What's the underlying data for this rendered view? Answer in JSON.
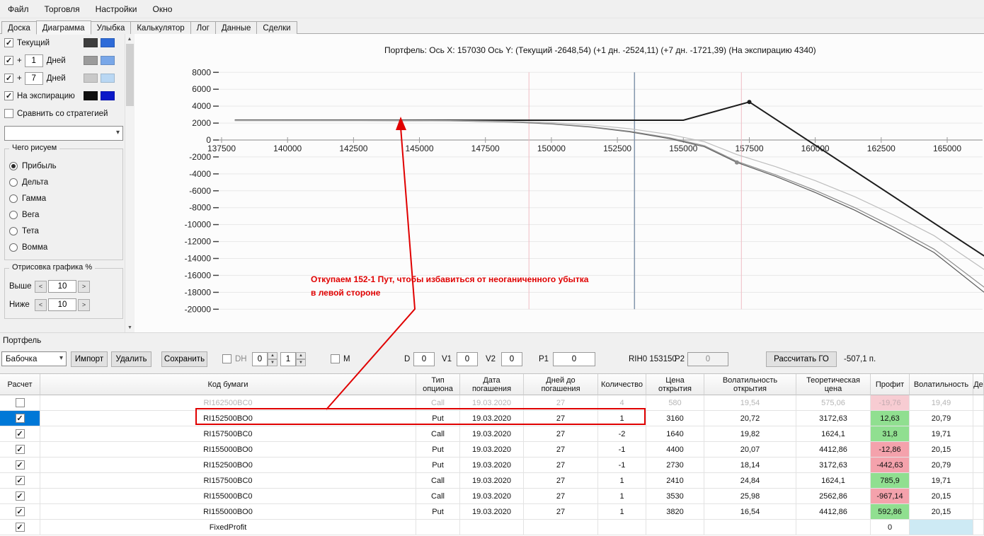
{
  "colors": {
    "profit_green": "#90df90",
    "profit_red": "#f4a2ac",
    "profit_red_faded": "#f7ccd2",
    "disabled_text": "#c4abb0",
    "row_selected": "#0078d7",
    "vol_blue": "#cdeaf4",
    "annotation_red": "#e00000"
  },
  "menu": {
    "items": [
      "Файл",
      "Торговля",
      "Настройки",
      "Окно"
    ]
  },
  "tabs": {
    "items": [
      "Доска",
      "Диаграмма",
      "Улыбка",
      "Калькулятор",
      "Лог",
      "Данные",
      "Сделки"
    ],
    "active": "Диаграмма"
  },
  "sidebar": {
    "toggles": [
      {
        "label": "Текущий",
        "checked": true,
        "swatch1": "#3d3d3d",
        "swatch2": "#2e6bd8"
      },
      {
        "prefix": "+",
        "value": "1",
        "label": "Дней",
        "checked": true,
        "swatch1": "#9b9b9b",
        "swatch2": "#79a7e8"
      },
      {
        "prefix": "+",
        "value": "7",
        "label": "Дней",
        "checked": true,
        "swatch1": "#c9c9c9",
        "swatch2": "#b9d7f3"
      },
      {
        "label": "На экспирацию",
        "checked": true,
        "swatch1": "#101010",
        "swatch2": "#0b18c8"
      }
    ],
    "compare": {
      "label": "Сравнить со стратегией",
      "checked": false
    },
    "draw": {
      "title": "Чего рисуем",
      "options": [
        "Прибыль",
        "Дельта",
        "Гамма",
        "Вега",
        "Тета",
        "Вомма"
      ],
      "selected": "Прибыль"
    },
    "scale": {
      "title": "Отрисовка графика %",
      "rows": [
        {
          "label": "Выше",
          "value": "10"
        },
        {
          "label": "Ниже",
          "value": "10"
        }
      ]
    }
  },
  "annotation": {
    "line1": "Откупаем 152-1 Пут, чтобы избавиться от неоганиченного убытка",
    "line2": "в левой стороне"
  },
  "portfolio": {
    "label": "Портфель",
    "strategy_value": "Бабочка",
    "import_btn": "Импорт",
    "delete_btn": "Удалить",
    "save_btn": "Сохранить",
    "dh_label": "DH",
    "dh_val1": "0",
    "dh_val2": "1",
    "m_label": "M",
    "d_label": "D",
    "d_value": "0",
    "v1_label": "V1",
    "v1_value": "0",
    "v2_label": "V2",
    "v2_value": "0",
    "p1_label": "P1",
    "p1_value": "0",
    "instrument": "RIH0 153150",
    "p2_label": "P2",
    "p2_value": "0",
    "calc_btn": "Рассчитать ГО",
    "margin_value": "-507,1 п."
  },
  "table": {
    "headers": [
      "Расчет",
      "Код бумаги",
      "Тип\nопциона",
      "Дата\nпогашения",
      "Дней до\nпогашения",
      "Количество",
      "Цена\nоткрытия",
      "Волатильность\nоткрытия",
      "Теоретическая\nцена",
      "Профит",
      "Волатильность",
      "Де"
    ],
    "rows": [
      {
        "checked": false,
        "selected": false,
        "disabled": true,
        "code": "RI162500BC0",
        "type": "Call",
        "expiry": "19.03.2020",
        "days": "27",
        "qty": "4",
        "open_price": "580",
        "open_vol": "19,54",
        "theo_price": "575,06",
        "profit": "-19,76",
        "profit_color": "red",
        "vol": "19,49",
        "vol_bg": ""
      },
      {
        "checked": true,
        "selected": true,
        "disabled": false,
        "code": "RI152500BO0",
        "type": "Put",
        "expiry": "19.03.2020",
        "days": "27",
        "qty": "1",
        "open_price": "3160",
        "open_vol": "20,72",
        "theo_price": "3172,63",
        "profit": "12,63",
        "profit_color": "green",
        "vol": "20,79",
        "vol_bg": ""
      },
      {
        "checked": true,
        "selected": false,
        "disabled": false,
        "code": "RI157500BC0",
        "type": "Call",
        "expiry": "19.03.2020",
        "days": "27",
        "qty": "-2",
        "open_price": "1640",
        "open_vol": "19,82",
        "theo_price": "1624,1",
        "profit": "31,8",
        "profit_color": "green",
        "vol": "19,71",
        "vol_bg": ""
      },
      {
        "checked": true,
        "selected": false,
        "disabled": false,
        "code": "RI155000BO0",
        "type": "Put",
        "expiry": "19.03.2020",
        "days": "27",
        "qty": "-1",
        "open_price": "4400",
        "open_vol": "20,07",
        "theo_price": "4412,86",
        "profit": "-12,86",
        "profit_color": "red",
        "vol": "20,15",
        "vol_bg": ""
      },
      {
        "checked": true,
        "selected": false,
        "disabled": false,
        "code": "RI152500BO0",
        "type": "Put",
        "expiry": "19.03.2020",
        "days": "27",
        "qty": "-1",
        "open_price": "2730",
        "open_vol": "18,14",
        "theo_price": "3172,63",
        "profit": "-442,63",
        "profit_color": "red",
        "vol": "20,79",
        "vol_bg": ""
      },
      {
        "checked": true,
        "selected": false,
        "disabled": false,
        "code": "RI157500BC0",
        "type": "Call",
        "expiry": "19.03.2020",
        "days": "27",
        "qty": "1",
        "open_price": "2410",
        "open_vol": "24,84",
        "theo_price": "1624,1",
        "profit": "785,9",
        "profit_color": "green",
        "vol": "19,71",
        "vol_bg": ""
      },
      {
        "checked": true,
        "selected": false,
        "disabled": false,
        "code": "RI155000BC0",
        "type": "Call",
        "expiry": "19.03.2020",
        "days": "27",
        "qty": "1",
        "open_price": "3530",
        "open_vol": "25,98",
        "theo_price": "2562,86",
        "profit": "-967,14",
        "profit_color": "red",
        "vol": "20,15",
        "vol_bg": ""
      },
      {
        "checked": true,
        "selected": false,
        "disabled": false,
        "code": "RI155000BO0",
        "type": "Put",
        "expiry": "19.03.2020",
        "days": "27",
        "qty": "1",
        "open_price": "3820",
        "open_vol": "16,54",
        "theo_price": "4412,86",
        "profit": "592,86",
        "profit_color": "green",
        "vol": "20,15",
        "vol_bg": ""
      },
      {
        "checked": true,
        "selected": false,
        "disabled": false,
        "code": "FixedProfit",
        "type": "",
        "expiry": "",
        "days": "",
        "qty": "",
        "open_price": "",
        "open_vol": "",
        "theo_price": "",
        "profit": "0",
        "profit_color": "none",
        "vol": "",
        "vol_bg": "blue"
      }
    ]
  },
  "chart_data": {
    "type": "line",
    "title": "Портфель: Ось X: 157030 Ось Y:  (Текущий -2648,54)  (+1 дн. -2524,11)  (+7 дн. -1721,39)  (На экспирацию 4340)",
    "xlim": [
      137200,
      166400
    ],
    "ylim": [
      -20000,
      8000
    ],
    "x_ticks": [
      137500,
      140000,
      142500,
      145000,
      147500,
      150000,
      152500,
      155000,
      157500,
      160000,
      162500,
      165000
    ],
    "y_ticks": [
      8000,
      6000,
      4000,
      2000,
      0,
      -2000,
      -4000,
      -6000,
      -8000,
      -10000,
      -12000,
      -14000,
      -16000,
      -18000,
      -20000
    ],
    "vlines": [
      {
        "x": 149150,
        "color": "#f0bcc4",
        "w": 1
      },
      {
        "x": 153150,
        "color": "#8295ac",
        "w": 1.5
      },
      {
        "x": 157200,
        "color": "#f0bcc4",
        "w": 1
      }
    ],
    "series": [
      {
        "name": "На экспирацию",
        "color": "#1c1c1c",
        "width": 2,
        "points": [
          [
            138000,
            2340
          ],
          [
            155000,
            2340
          ],
          [
            157500,
            4500
          ],
          [
            166400,
            -13700
          ]
        ]
      },
      {
        "name": "Текущий",
        "color": "#5a5a5a",
        "width": 1.2,
        "points": [
          [
            138000,
            2300
          ],
          [
            144000,
            2290
          ],
          [
            146500,
            2250
          ],
          [
            148500,
            2120
          ],
          [
            150000,
            1900
          ],
          [
            151500,
            1520
          ],
          [
            153000,
            950
          ],
          [
            154500,
            150
          ],
          [
            155800,
            -800
          ],
          [
            157030,
            -2648
          ],
          [
            158500,
            -4300
          ],
          [
            160000,
            -6200
          ],
          [
            161500,
            -8300
          ],
          [
            163000,
            -10700
          ],
          [
            164500,
            -13300
          ],
          [
            166400,
            -18000
          ]
        ]
      },
      {
        "name": "+1 день",
        "color": "#8d8d8d",
        "width": 1.2,
        "points": [
          [
            138000,
            2300
          ],
          [
            144000,
            2292
          ],
          [
            146500,
            2260
          ],
          [
            148500,
            2140
          ],
          [
            150000,
            1930
          ],
          [
            151500,
            1570
          ],
          [
            153000,
            1020
          ],
          [
            154500,
            250
          ],
          [
            155800,
            -680
          ],
          [
            157030,
            -2524
          ],
          [
            158500,
            -4120
          ],
          [
            160000,
            -5950
          ],
          [
            161500,
            -8000
          ],
          [
            163000,
            -10350
          ],
          [
            164500,
            -12900
          ],
          [
            166400,
            -17400
          ]
        ]
      },
      {
        "name": "+7 дней",
        "color": "#bdbdbd",
        "width": 1.2,
        "points": [
          [
            138000,
            2310
          ],
          [
            144000,
            2305
          ],
          [
            146500,
            2285
          ],
          [
            148500,
            2210
          ],
          [
            150000,
            2060
          ],
          [
            151500,
            1780
          ],
          [
            153000,
            1320
          ],
          [
            154500,
            640
          ],
          [
            155800,
            -200
          ],
          [
            157030,
            -1721
          ],
          [
            158500,
            -3150
          ],
          [
            160000,
            -4800
          ],
          [
            161500,
            -6700
          ],
          [
            163000,
            -8900
          ],
          [
            164500,
            -11300
          ],
          [
            166400,
            -15300
          ]
        ]
      }
    ],
    "markers": [
      {
        "x": 157500,
        "y": 4500,
        "color": "#1c1c1c"
      },
      {
        "x": 157030,
        "y": -2648,
        "color": "#8a8a8a"
      }
    ]
  }
}
